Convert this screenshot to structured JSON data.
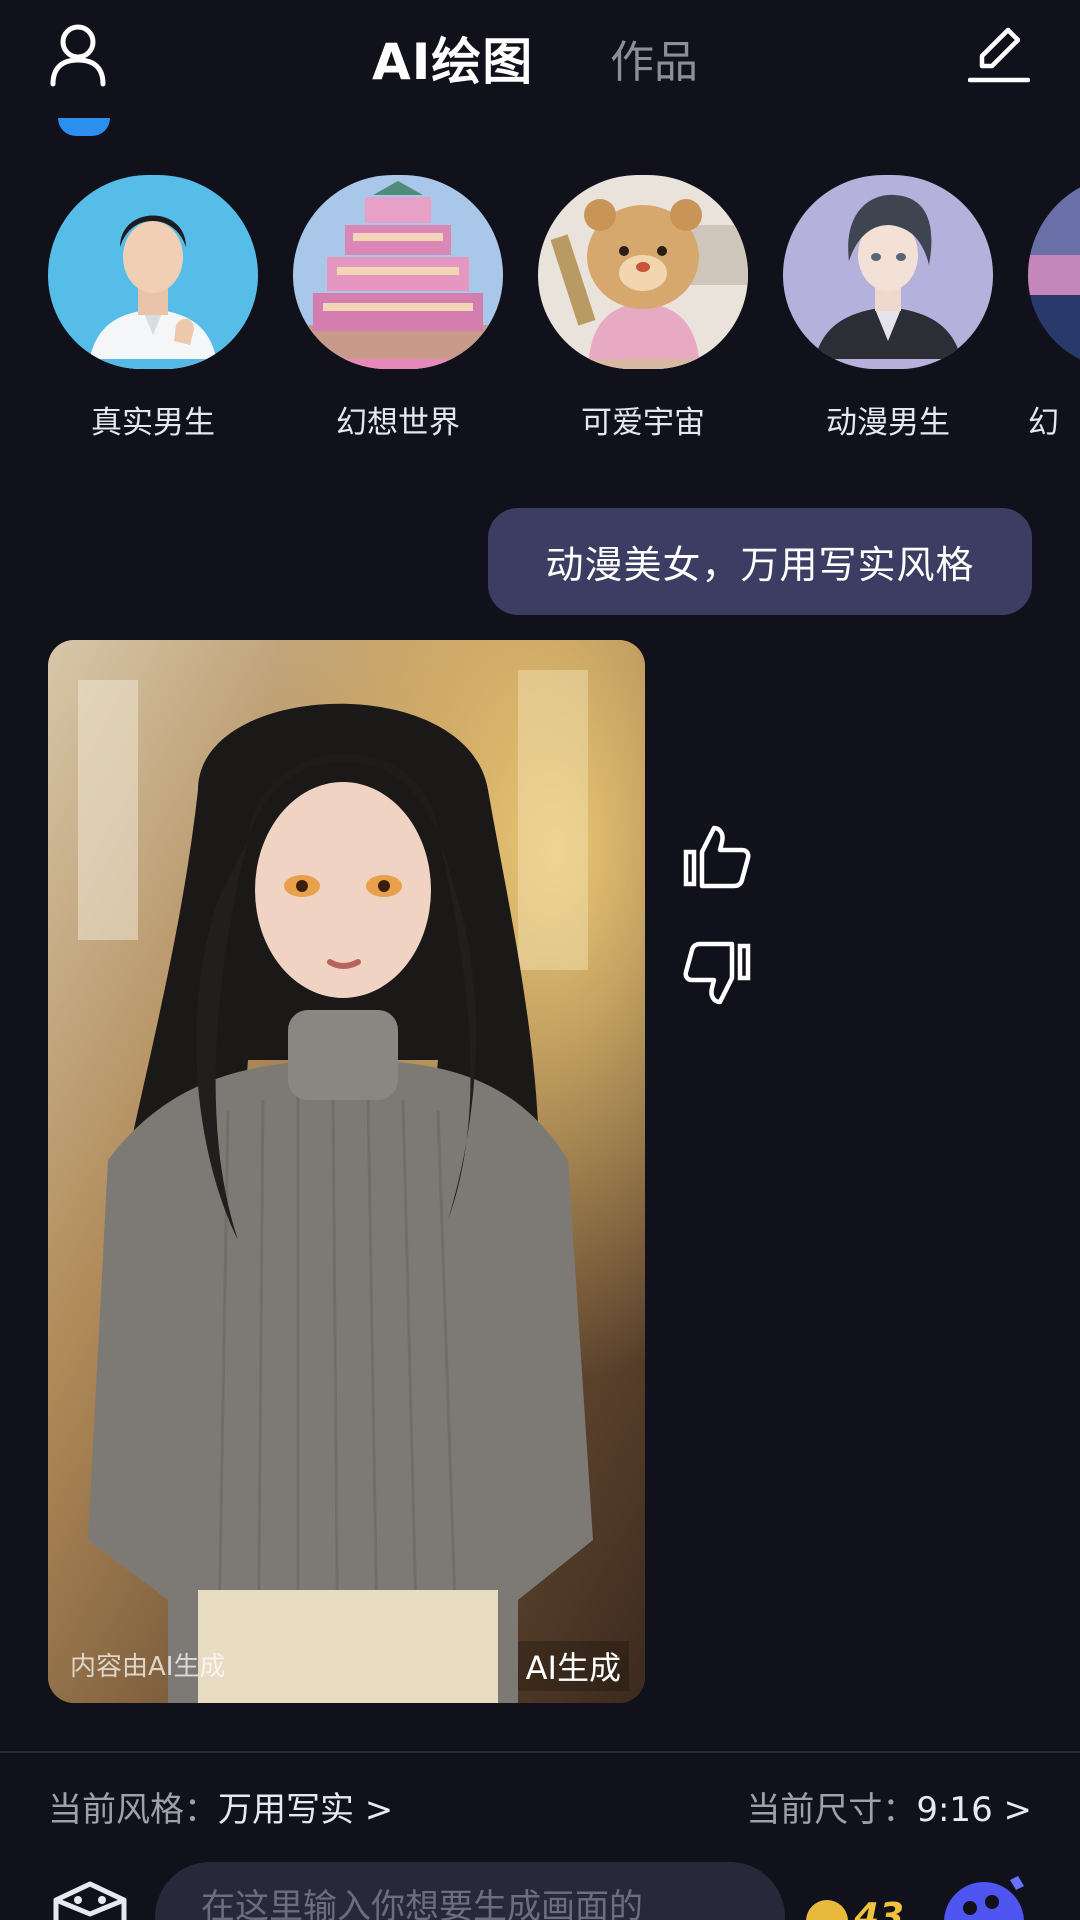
{
  "header": {
    "active_tab": "AI绘图",
    "tab_works": "作品"
  },
  "styles": [
    {
      "label": "真实男生",
      "strip": "#55b9e6"
    },
    {
      "label": "幻想世界",
      "strip": "#e68ab9"
    },
    {
      "label": "可爱宇宙",
      "strip": "#d8b9a4"
    },
    {
      "label": "动漫男生",
      "strip": "#b7b1db"
    },
    {
      "label": "幻",
      "strip": "#8aa8d8"
    }
  ],
  "chat": {
    "user_message": "动漫美女，万用写实风格",
    "image_watermark_left": "内容由AI生成",
    "image_watermark_right": "AI生成"
  },
  "footer": {
    "style_label": "当前风格：",
    "style_value": "万用写实 >",
    "size_label": "当前尺寸：",
    "size_value": "9:16 >",
    "input_placeholder": "在这里输入你想要生成画面的",
    "coins": "43"
  },
  "colors": {
    "background": "#10111b",
    "bubble": "#3c3d62",
    "input_bg": "#272839",
    "coin": "#f0c23d",
    "accent_blue": "#2c8ff0"
  }
}
